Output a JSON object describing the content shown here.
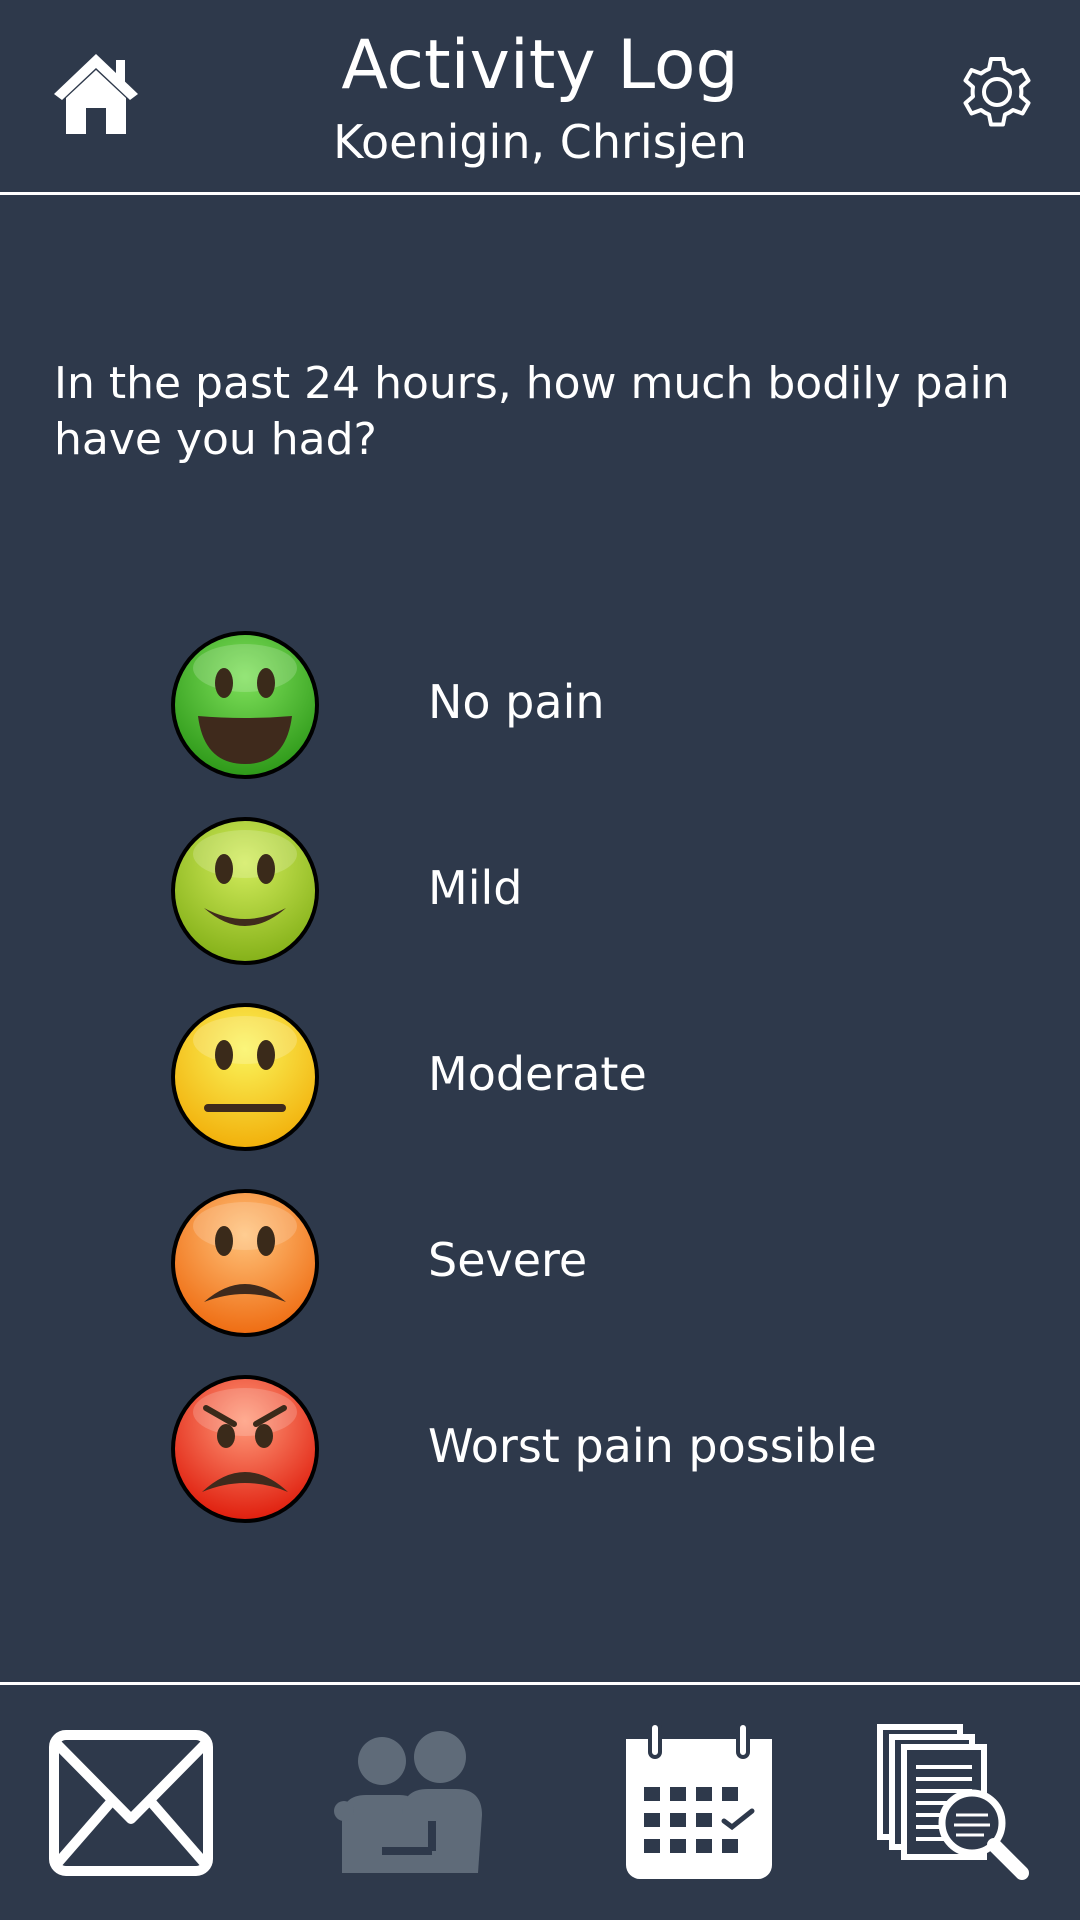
{
  "header": {
    "title": "Activity Log",
    "subtitle": "Koenigin, Chrisjen"
  },
  "question": "In the past 24 hours, how much bodily pain have you had?",
  "options": [
    {
      "label": "No pain",
      "icon": "very-happy-face-icon",
      "color": "#4cb82a"
    },
    {
      "label": "Mild",
      "icon": "happy-face-icon",
      "color": "#a7cc24"
    },
    {
      "label": "Moderate",
      "icon": "neutral-face-icon",
      "color": "#f0d61a"
    },
    {
      "label": "Severe",
      "icon": "sad-face-icon",
      "color": "#f18526"
    },
    {
      "label": "Worst pain possible",
      "icon": "angry-face-icon",
      "color": "#e83a21"
    }
  ],
  "nav": [
    {
      "icon": "mail-icon",
      "state": "active"
    },
    {
      "icon": "people-icon",
      "state": "disabled"
    },
    {
      "icon": "calendar-icon",
      "state": "active"
    },
    {
      "icon": "documents-search-icon",
      "state": "active"
    }
  ],
  "colors": {
    "background": "#2e394b",
    "foreground": "#ffffff",
    "disabled_icon": "#5f6b79"
  }
}
